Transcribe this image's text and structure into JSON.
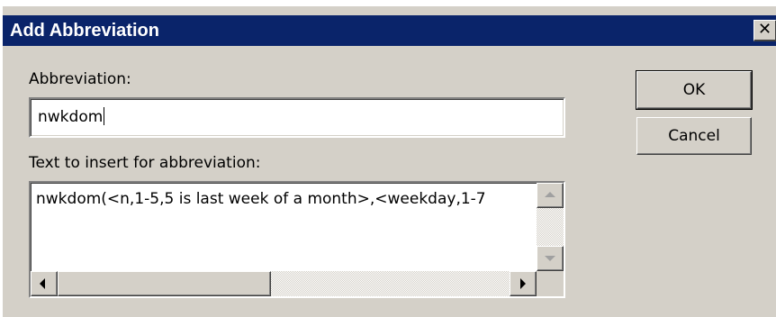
{
  "window": {
    "title": "Add Abbreviation",
    "close_glyph": "✕"
  },
  "form": {
    "abbreviation_label": "Abbreviation:",
    "abbreviation_value": "nwkdom",
    "text_label": "Text to insert for abbreviation:",
    "text_value": "nwkdom(<n,1-5,5 is last week of a month>,<weekday,1-7"
  },
  "buttons": {
    "ok_label": "OK",
    "cancel_label": "Cancel"
  },
  "icons": {
    "close": "close-icon",
    "scroll_up": "scroll-up-arrow-icon",
    "scroll_down": "scroll-down-arrow-icon",
    "scroll_left": "scroll-left-arrow-icon",
    "scroll_right": "scroll-right-arrow-icon"
  },
  "colors": {
    "titlebar": "#0a246a",
    "dialog_face": "#d4d0c8",
    "field_background": "#ffffff"
  }
}
